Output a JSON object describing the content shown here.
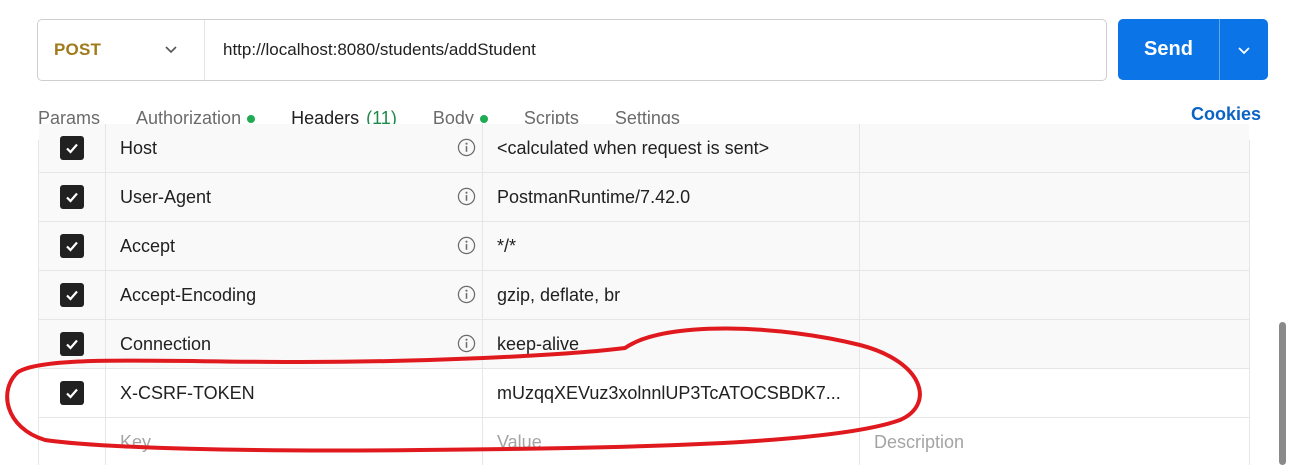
{
  "request": {
    "method": "POST",
    "url": "http://localhost:8080/students/addStudent",
    "send_label": "Send"
  },
  "tabs": [
    {
      "label": "Params"
    },
    {
      "label": "Authorization"
    },
    {
      "label": "Headers",
      "count": "(11)"
    },
    {
      "label": "Body"
    },
    {
      "label": "Scripts"
    },
    {
      "label": "Settings"
    }
  ],
  "cookies_label": "Cookies",
  "headers": [
    {
      "key": "Host",
      "value": "<calculated when request is sent>"
    },
    {
      "key": "User-Agent",
      "value": "PostmanRuntime/7.42.0"
    },
    {
      "key": "Accept",
      "value": "*/*"
    },
    {
      "key": "Accept-Encoding",
      "value": "gzip, deflate, br"
    },
    {
      "key": "Connection",
      "value": "keep-alive"
    },
    {
      "key": "X-CSRF-TOKEN",
      "value": "mUzqqXEVuz3xolnnlUP3TcATOCSBDK7..."
    }
  ],
  "new_row": {
    "key_placeholder": "Key",
    "value_placeholder": "Value",
    "description_placeholder": "Description"
  },
  "colors": {
    "send": "#0b74e6",
    "method": "#a07a1a",
    "active_tab_underline": "#ff6c37",
    "status_dot": "#1faa54",
    "annotation": "#e0191e"
  }
}
